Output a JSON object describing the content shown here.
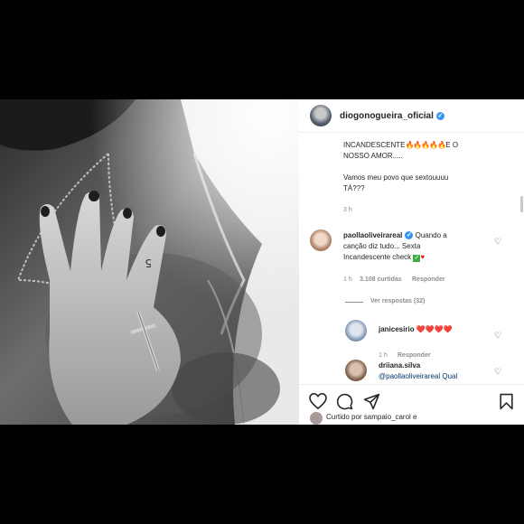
{
  "post": {
    "username": "diogonogueira_oficial",
    "caption": {
      "line1_text": "INCANDESCENTE",
      "line1_emojis": "🔥🔥🔥🔥🔥",
      "line1_tail": "E O",
      "line2": "NOSSO AMOR.....",
      "line3": "Vamos meu povo que sextouuuu",
      "line4": "TÁ???",
      "time": "3 h"
    }
  },
  "comments": [
    {
      "username": "paollaoliveirareal",
      "text_a": "Quando a",
      "text_b": "canção diz tudo... Sexta",
      "text_c": "Incandescente check",
      "time": "1 h",
      "likes": "3.108 curtidas",
      "reply": "Responder",
      "view_replies": "Ver respostas (32)"
    },
    {
      "username": "janicesirio",
      "hearts": "❤️❤️❤️❤️",
      "time": "1 h",
      "reply": "Responder"
    },
    {
      "username": "driiana.silva",
      "text": "@paollaoliveirareal Qual"
    }
  ],
  "footer": {
    "liked_by": "Curtido por sampaio_carol e"
  },
  "colors": {
    "verified": "#3897f0",
    "meta_gray": "#8e8e8e",
    "text": "#262626"
  },
  "icons": [
    "heart-icon",
    "comment-icon",
    "share-icon",
    "save-icon",
    "verified-icon"
  ]
}
